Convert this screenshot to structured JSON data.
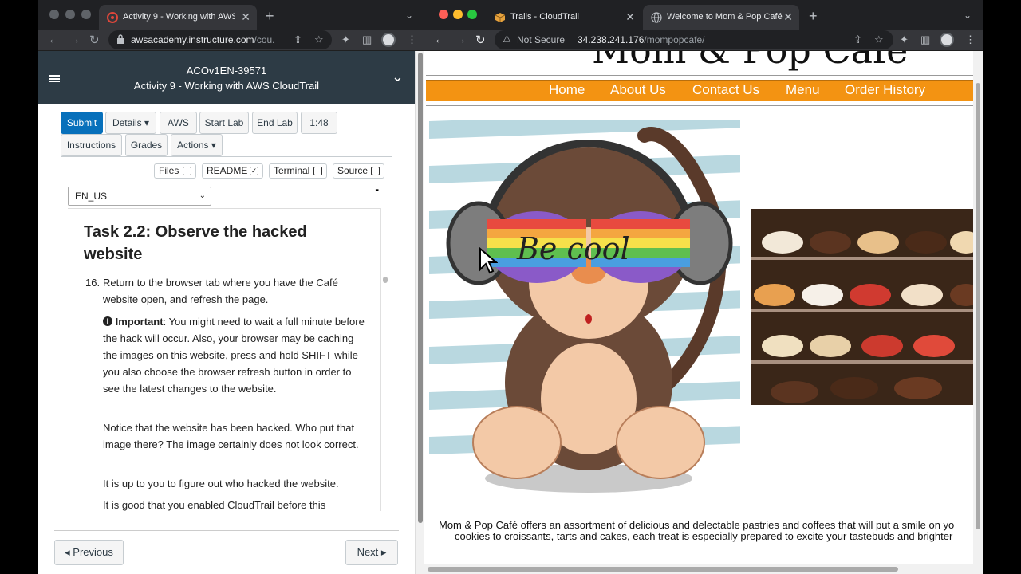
{
  "left_window": {
    "tab": {
      "title": "Activity 9 - Working with AWS",
      "close": "✕"
    },
    "new_tab": "+",
    "url": {
      "host": "awsacademy.instructure.com",
      "path": "/cou..."
    },
    "course": {
      "code": "ACOv1EN-39571",
      "title": "Activity 9 - Working with AWS CloudTrail"
    },
    "buttons": {
      "submit": "Submit",
      "details": "Details ▾",
      "aws": "AWS",
      "start_lab": "Start Lab",
      "end_lab": "End Lab",
      "timer": "1:48",
      "instructions": "Instructions",
      "grades": "Grades",
      "actions": "Actions ▾"
    },
    "toggles": {
      "files": "Files",
      "readme": "README",
      "terminal": "Terminal",
      "source": "Source"
    },
    "language": "EN_US",
    "collapse": "-",
    "task_heading": "Task 2.2: Observe the hacked website",
    "step_number": "16.",
    "paragraphs": [
      "Return to the browser tab where you have the Café website open, and refresh the page.",
      "Important",
      ": You might need to wait a full minute before the hack will occur. Also, your browser may be caching the images on this website, press and hold SHIFT while you also choose the browser refresh button in order to see the latest changes to the website.",
      "Notice that the website has been hacked. Who put that image there? The image certainly does not look correct.",
      "It is up to you to figure out who hacked the website.",
      "It is good that you enabled CloudTrail before this"
    ],
    "pager": {
      "previous": "◂ Previous",
      "next": "Next ▸"
    }
  },
  "right_window": {
    "tabs": [
      {
        "title": "Trails - CloudTrail",
        "close": "✕"
      },
      {
        "title": "Welcome to Mom & Pop Café!",
        "close": "✕"
      }
    ],
    "new_tab": "+",
    "security": "Not Secure",
    "url": {
      "host": "34.238.241.176",
      "path": "/mompopcafe/"
    },
    "site": {
      "logo_text": "Mom & Pop Café",
      "nav": [
        "Home",
        "About Us",
        "Contact Us",
        "Menu",
        "Order History"
      ],
      "hacked_image_text": "Be cool",
      "footer_line1": "Mom & Pop Café offers an assortment of delicious and delectable pastries and coffees that will put a smile on yo",
      "footer_line2": "cookies to croissants, tarts and cakes, each treat is especially prepared to excite your tastebuds and brighter"
    }
  },
  "colors": {
    "nav_orange": "#f39312",
    "lms_header": "#2d3b45",
    "submit_blue": "#0770bb",
    "chrome_dark": "#202124"
  }
}
